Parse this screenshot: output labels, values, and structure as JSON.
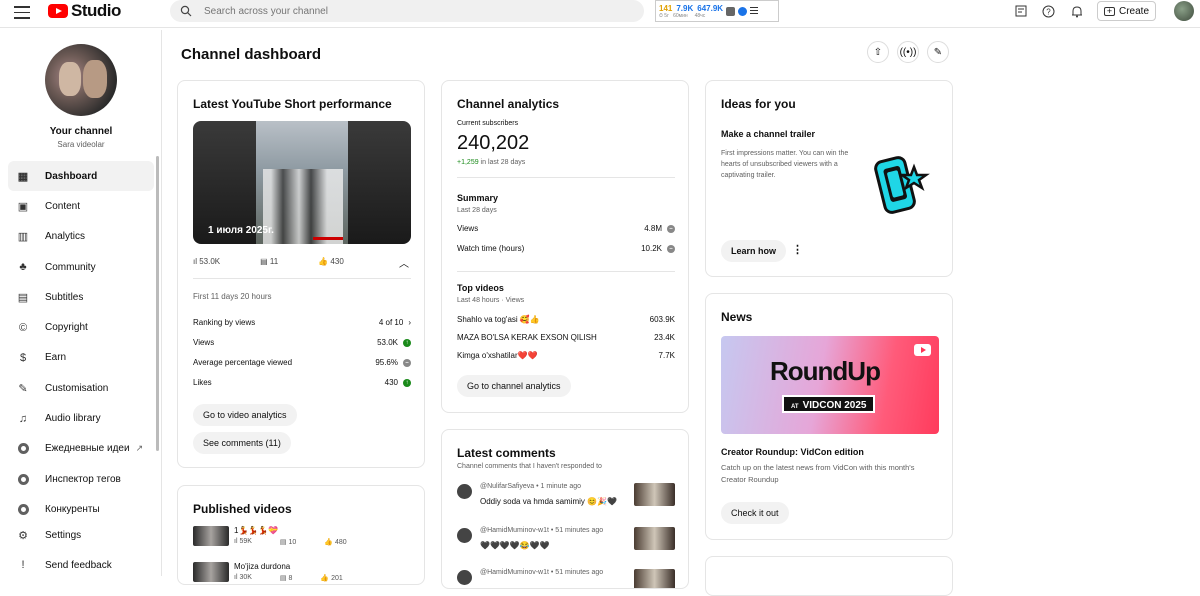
{
  "topbar": {
    "app_name": "Studio",
    "search_placeholder": "Search across your channel",
    "ext_num1": "141",
    "ext_num2": "7.9K",
    "ext_num3": "647.9K",
    "ext_sub1": "⏱ 5г",
    "ext_sub2": "60мин",
    "ext_sub3": "48чс",
    "create_label": "Create"
  },
  "sidebar": {
    "channel_title": "Your channel",
    "channel_subtitle": "Sara videolar",
    "items": [
      {
        "label": "Dashboard",
        "icon": "dashboard-icon",
        "glyph": "▦"
      },
      {
        "label": "Content",
        "icon": "content-icon",
        "glyph": "▣"
      },
      {
        "label": "Analytics",
        "icon": "analytics-icon",
        "glyph": "▥"
      },
      {
        "label": "Community",
        "icon": "community-icon",
        "glyph": "♣"
      },
      {
        "label": "Subtitles",
        "icon": "subtitles-icon",
        "glyph": "▤"
      },
      {
        "label": "Copyright",
        "icon": "copyright-icon",
        "glyph": "©"
      },
      {
        "label": "Earn",
        "icon": "earn-icon",
        "glyph": "$"
      },
      {
        "label": "Customisation",
        "icon": "customisation-icon",
        "glyph": "✎"
      },
      {
        "label": "Audio library",
        "icon": "audio-library-icon",
        "glyph": "♫"
      },
      {
        "label": "Ежедневные идеи",
        "icon": "ext-icon"
      },
      {
        "label": "Инспектор тегов",
        "icon": "ext-icon"
      },
      {
        "label": "Конкуренты",
        "icon": "ext-icon"
      }
    ],
    "bottom_items": [
      {
        "label": "Settings",
        "icon": "settings-icon",
        "glyph": "⚙"
      },
      {
        "label": "Send feedback",
        "icon": "feedback-icon",
        "glyph": "!"
      }
    ]
  },
  "page": {
    "title": "Channel dashboard"
  },
  "short_card": {
    "title": "Latest YouTube Short performance",
    "thumb_date": "1 июля 2025г.",
    "views": "53.0K",
    "comments": "11",
    "likes": "430",
    "period": "First 11 days 20 hours",
    "rows": [
      {
        "label": "Ranking by views",
        "value": "4 of 10"
      },
      {
        "label": "Views",
        "value": "53.0K"
      },
      {
        "label": "Average percentage viewed",
        "value": "95.6%"
      },
      {
        "label": "Likes",
        "value": "430"
      }
    ],
    "btn_analytics": "Go to video analytics",
    "btn_comments": "See comments (11)"
  },
  "published_card": {
    "title": "Published videos",
    "videos": [
      {
        "title": "1💃💃💃💝",
        "views": "59K",
        "comments": "10",
        "likes": "480"
      },
      {
        "title": "Mo'jiza durdona",
        "views": "30K",
        "comments": "8",
        "likes": "201"
      }
    ]
  },
  "analytics_card": {
    "title": "Channel analytics",
    "subs_label": "Current subscribers",
    "subs_value": "240,202",
    "subs_change": "+1,259",
    "subs_change_suffix": " in last 28 days",
    "summary_title": "Summary",
    "summary_sub": "Last 28 days",
    "summary_rows": [
      {
        "label": "Views",
        "value": "4.8M"
      },
      {
        "label": "Watch time (hours)",
        "value": "10.2K"
      }
    ],
    "top_title": "Top videos",
    "top_sub": "Last 48 hours · Views",
    "top_rows": [
      {
        "label": "Shahlo va tog'asi 🥰👍",
        "value": "603.9K"
      },
      {
        "label": "MAZA BO'LSA KERAK EXSON QILISH",
        "value": "23.4K"
      },
      {
        "label": "Kimga o'xshatilar❤️❤️",
        "value": "7.7K"
      }
    ],
    "btn": "Go to channel analytics"
  },
  "comments_card": {
    "title": "Latest comments",
    "subtitle": "Channel comments that I haven't responded to",
    "comments": [
      {
        "author": "@NulifarSafiyeva • 1 minute ago",
        "text": "Oddiy soda va hmda samimiy 😊🎉🖤"
      },
      {
        "author": "@HamidMuminov-w1t • 51 minutes ago",
        "text": "🖤🖤🖤🖤😂🖤🖤"
      },
      {
        "author": "@HamidMuminov-w1t • 51 minutes ago",
        "text": ""
      }
    ]
  },
  "ideas_card": {
    "title": "Ideas for you",
    "subtitle": "Make a channel trailer",
    "text": "First impressions matter. You can win the hearts of unsubscribed viewers with a captivating trailer.",
    "btn": "Learn how"
  },
  "news_card": {
    "title": "News",
    "img_title": "RoundUp",
    "img_at": "AT",
    "img_vidcon": "VIDCON 2025",
    "headline": "Creator Roundup: VidCon edition",
    "text": "Catch up on the latest news from VidCon with this month's Creator Roundup",
    "btn": "Check it out"
  },
  "colors": {
    "accent_red": "#ff0000",
    "positive_green": "#1a8a1a",
    "trailer_cyan": "#1fd6e6"
  }
}
